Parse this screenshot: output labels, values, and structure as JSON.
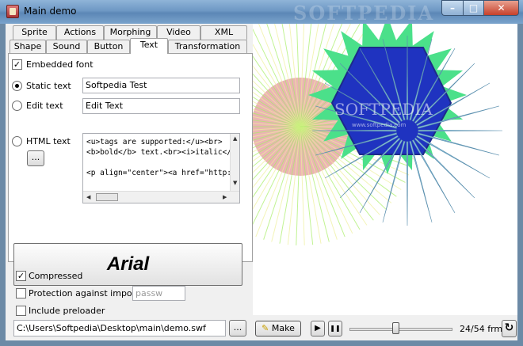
{
  "window": {
    "title": "Main demo",
    "watermark": "SOFTPEDIA",
    "min_glyph": "–",
    "max_glyph": "□",
    "close_glyph": "✕"
  },
  "tabs_row1": [
    "Sprite",
    "Actions",
    "Morphing",
    "Video",
    "XML"
  ],
  "tabs_row2": [
    "Shape",
    "Sound",
    "Button",
    "Text",
    "Transformation"
  ],
  "active_tab": "Text",
  "text_tab": {
    "embedded_font_label": "Embedded font",
    "embedded_font_checked": true,
    "static_text_label": "Static text",
    "static_text_value": "Softpedia Test",
    "edit_text_label": "Edit text",
    "edit_text_value": "Edit Text",
    "html_text_label": "HTML text",
    "html_lines": [
      "<u>tags are supported:</u><br>",
      "<b>bold</b> text.<br><i>italic</",
      "",
      "<p align=\"center\"><a href=\"http:/,"
    ],
    "browse_label": "...",
    "selected_mode": "static",
    "font_button_label": "Arial"
  },
  "options": {
    "compressed_label": "Compressed",
    "compressed_checked": true,
    "protection_label": "Protection against import",
    "protection_checked": false,
    "password_placeholder": "passw",
    "preloader_label": "Include preloader",
    "preloader_checked": false
  },
  "output": {
    "path": "C:\\Users\\Softpedia\\Desktop\\main\\demo.swf",
    "browse_label": "..."
  },
  "player": {
    "make_label": "Make",
    "play_glyph": "▶",
    "pause_glyph": "❚❚",
    "frame_status": "24/54 frm",
    "frame_current": 24,
    "frame_total": 54,
    "loop_glyph": "↻"
  },
  "canvas": {
    "watermark_text": "SOFTPEDIA",
    "watermark_sub": "www.softpedia.com",
    "colors": {
      "hexagon": "#1f33c0",
      "hexagon_edge": "#1d2a8a",
      "star_green": "#4be08a",
      "burst_pink": "#e8a7a7",
      "burst_lime": "#a8ee66",
      "burst_yellow": "#eef09a",
      "star_blue": "#8ac2dc"
    }
  }
}
